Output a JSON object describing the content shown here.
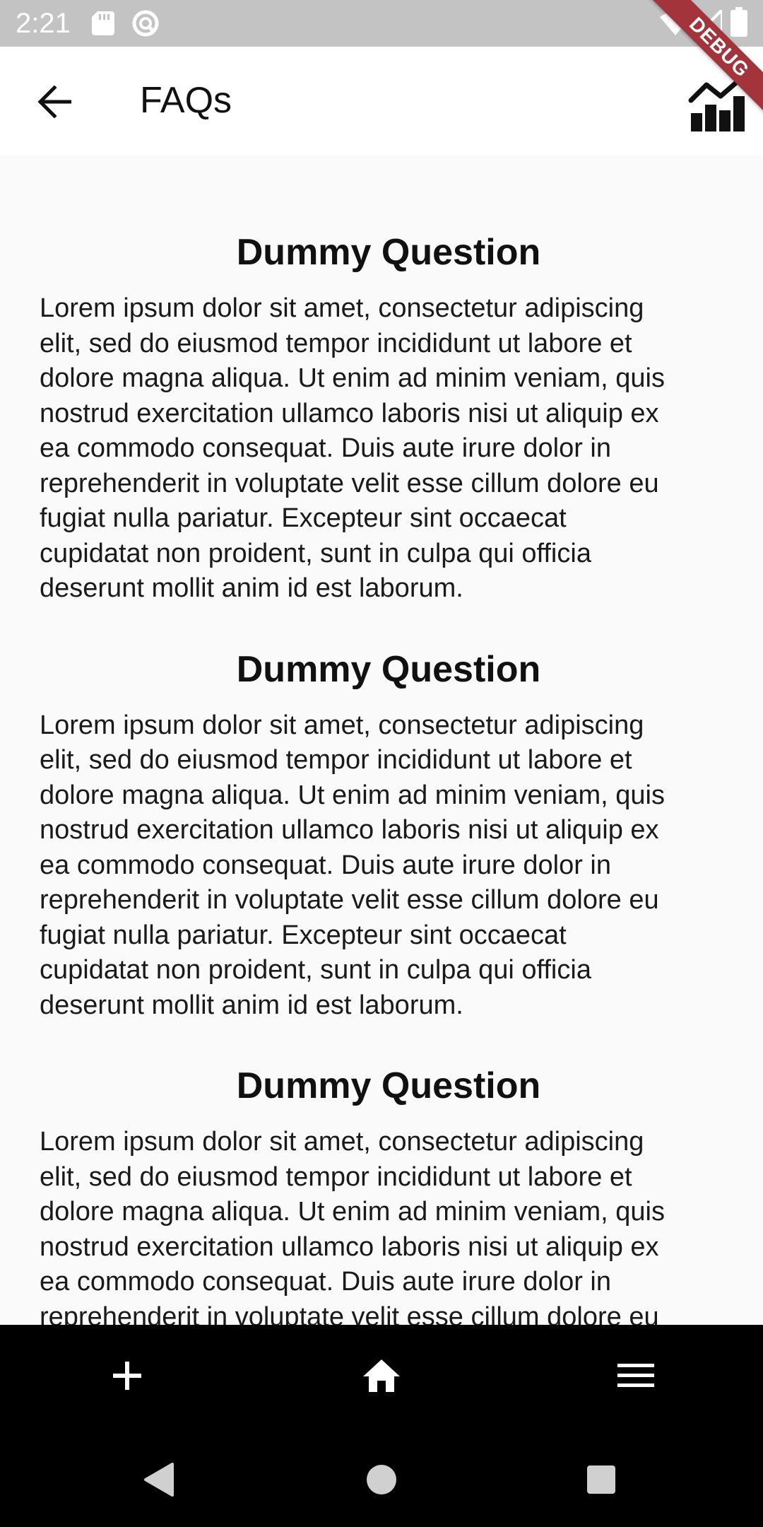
{
  "status_bar": {
    "time": "2:21"
  },
  "debug_banner": "DEBUG",
  "app_bar": {
    "title": "FAQs",
    "back_icon": "arrow-back-icon",
    "action_icon": "chart-icon"
  },
  "faqs": [
    {
      "question": "Dummy Question",
      "answer": "Lorem ipsum dolor sit amet, consectetur adipiscing\nelit, sed do eiusmod tempor incididunt ut labore et\ndolore magna aliqua. Ut enim ad minim veniam, quis\nnostrud exercitation ullamco laboris nisi ut aliquip ex\nea commodo consequat. Duis aute irure dolor in\nreprehenderit in voluptate velit esse cillum dolore eu\nfugiat nulla pariatur. Excepteur sint occaecat\ncupidatat non proident, sunt in culpa qui officia\ndeserunt mollit anim id est laborum."
    },
    {
      "question": "Dummy Question",
      "answer": "Lorem ipsum dolor sit amet, consectetur adipiscing\nelit, sed do eiusmod tempor incididunt ut labore et\ndolore magna aliqua. Ut enim ad minim veniam, quis\nnostrud exercitation ullamco laboris nisi ut aliquip ex\nea commodo consequat. Duis aute irure dolor in\nreprehenderit in voluptate velit esse cillum dolore eu\nfugiat nulla pariatur. Excepteur sint occaecat\ncupidatat non proident, sunt in culpa qui officia\ndeserunt mollit anim id est laborum."
    },
    {
      "question": "Dummy Question",
      "answer": "Lorem ipsum dolor sit amet, consectetur adipiscing\nelit, sed do eiusmod tempor incididunt ut labore et\ndolore magna aliqua. Ut enim ad minim veniam, quis\nnostrud exercitation ullamco laboris nisi ut aliquip ex\nea commodo consequat. Duis aute irure dolor in\nreprehenderit in voluptate velit esse cillum dolore eu\nfugiat nulla pariatur. Excepteur sint occaecat\ncupidatat non proident, sunt in culpa qui officia\ndeserunt mollit anim id est laborum."
    }
  ],
  "bottom_nav": {
    "items": [
      "add-icon",
      "home-icon",
      "menu-icon"
    ]
  },
  "system_nav": {
    "items": [
      "back-triangle-icon",
      "home-circle-icon",
      "recents-square-icon"
    ]
  },
  "colors": {
    "status_bar": "#c3c3c3",
    "app_bar": "#ffffff",
    "background": "#fafafa",
    "nav_bar": "#000000",
    "debug_ribbon": "#a3343b",
    "text": "#111111"
  }
}
